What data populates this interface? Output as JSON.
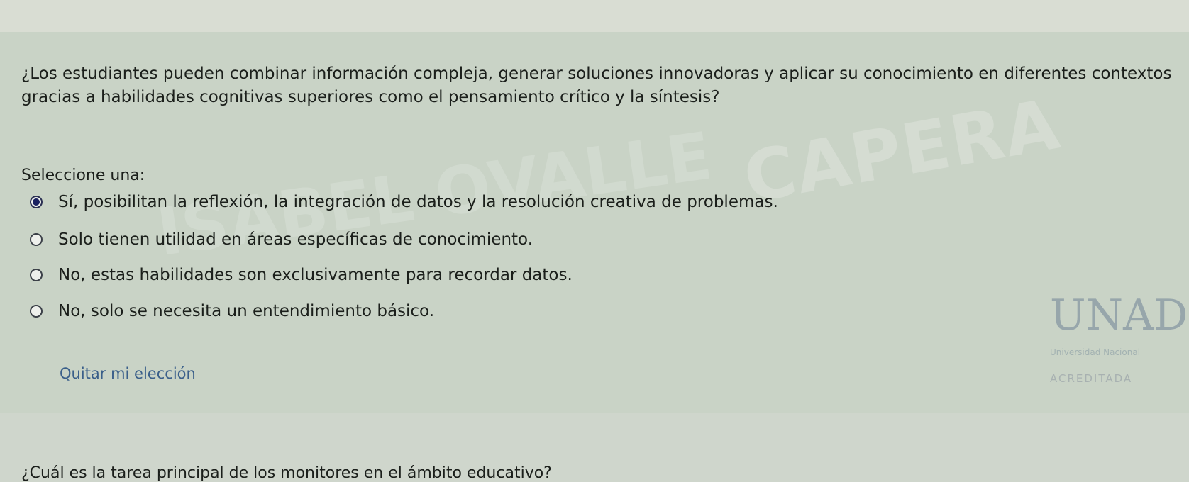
{
  "question": {
    "text": "¿Los estudiantes pueden combinar información compleja, generar soluciones innovadoras y aplicar su conocimiento en diferentes contextos gracias a habilidades cognitivas superiores como el pensamiento crítico y la síntesis?",
    "prompt": "Seleccione una:",
    "options": [
      {
        "label": "Sí, posibilitan la reflexión, la integración de datos y la resolución creativa de problemas.",
        "selected": true
      },
      {
        "label": "Solo tienen utilidad en áreas específicas de conocimiento.",
        "selected": false
      },
      {
        "label": "No, estas habilidades son exclusivamente para recordar datos.",
        "selected": false
      },
      {
        "label": "No, solo se necesita un entendimiento básico.",
        "selected": false
      }
    ],
    "clear_choice": "Quitar mi elección"
  },
  "watermark": {
    "word1": "CAPERA",
    "word2": "ISABEL OVALLE"
  },
  "logo": {
    "mark": "UNAD",
    "subtitle": "Universidad Nacional",
    "badge": "ACREDITADA"
  },
  "next_question": {
    "text": "¿Cuál es la tarea principal de los monitores en el ámbito educativo?"
  },
  "colors": {
    "background": "#cfd6cc",
    "card": "#c9d3c6",
    "text": "#1b1f1b",
    "link": "#3a5f8a",
    "radio_selected": "#1a2160"
  }
}
